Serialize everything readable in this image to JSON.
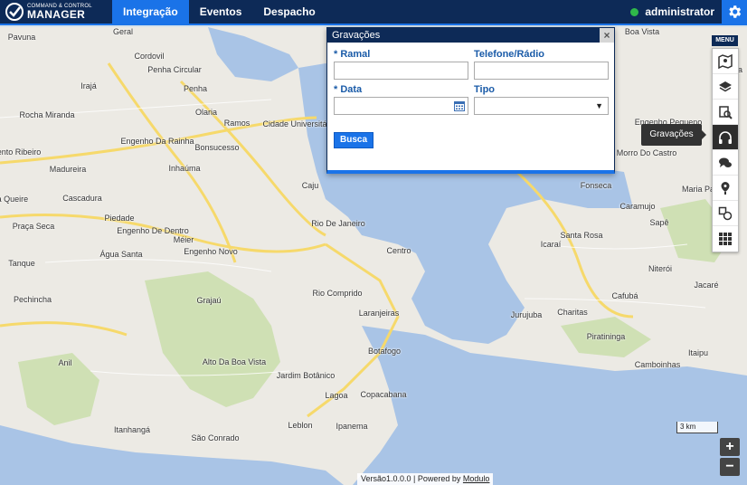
{
  "brand": {
    "line1": "COMMAND & CONTROL",
    "line2": "MANAGER"
  },
  "nav": {
    "tabs": [
      {
        "label": "Integração"
      },
      {
        "label": "Eventos"
      },
      {
        "label": "Despacho"
      }
    ]
  },
  "user": {
    "name": "administrator",
    "status_color": "#2fb84a"
  },
  "menu": {
    "title": "MENU",
    "tooltip": "Gravações",
    "items": [
      {
        "icon": "map-icon"
      },
      {
        "icon": "layers-icon"
      },
      {
        "icon": "camera-search-icon"
      },
      {
        "icon": "headphones-icon"
      },
      {
        "icon": "chat-icon"
      },
      {
        "icon": "location-pin-icon"
      },
      {
        "icon": "shapes-icon"
      },
      {
        "icon": "grid-icon"
      }
    ]
  },
  "dialog": {
    "title": "Gravações",
    "close": "×",
    "ramal_label": "* Ramal",
    "telefone_label": "Telefone/Rádio",
    "data_label": "* Data",
    "tipo_label": "Tipo",
    "search_button": "Busca"
  },
  "map": {
    "scale": "3 km",
    "zoom_in": "+",
    "zoom_out": "−",
    "labels": [
      "Pavuna",
      "Geral",
      "Cordovil",
      "Penha Circular",
      "Penha",
      "Irajá",
      "Olaria",
      "Ramos",
      "Rocha Miranda",
      "Engenho Da Rainha",
      "Bonsucesso",
      "Cidade Universitária",
      "Madureira",
      "Inhaúma",
      "Bento Ribeiro",
      "Cascadura",
      "Vila Queire",
      "Piedade",
      "Engenho De Dentro",
      "Méier",
      "Caju",
      "Praça Seca",
      "Água Santa",
      "Engenho Novo",
      "Rio De Janeiro",
      "Centro",
      "Tanque",
      "Pechincha",
      "Grajaú",
      "Rio Comprido",
      "Laranjeiras",
      "Botafogo",
      "Anil",
      "Alto Da Boa Vista",
      "Jardim Botânico",
      "Lagoa",
      "Copacabana",
      "Leblon",
      "Ipanema",
      "Itanhangá",
      "São Conrado",
      "Jurujuba",
      "Charitas",
      "Icaraí",
      "Santa Rosa",
      "Niterói",
      "Fonseca",
      "Caramujo",
      "Sapê",
      "Piratininga",
      "Cafubá",
      "Camboinhas",
      "Itaipu",
      "Jacaré",
      "Boa Vista",
      "Rocha",
      "Engenho Pequeno",
      "Morro Do Castro",
      "Maria Paula"
    ]
  },
  "footer": {
    "version": "Versão1.0.0.0 | Powered by ",
    "link": "Modulo"
  }
}
